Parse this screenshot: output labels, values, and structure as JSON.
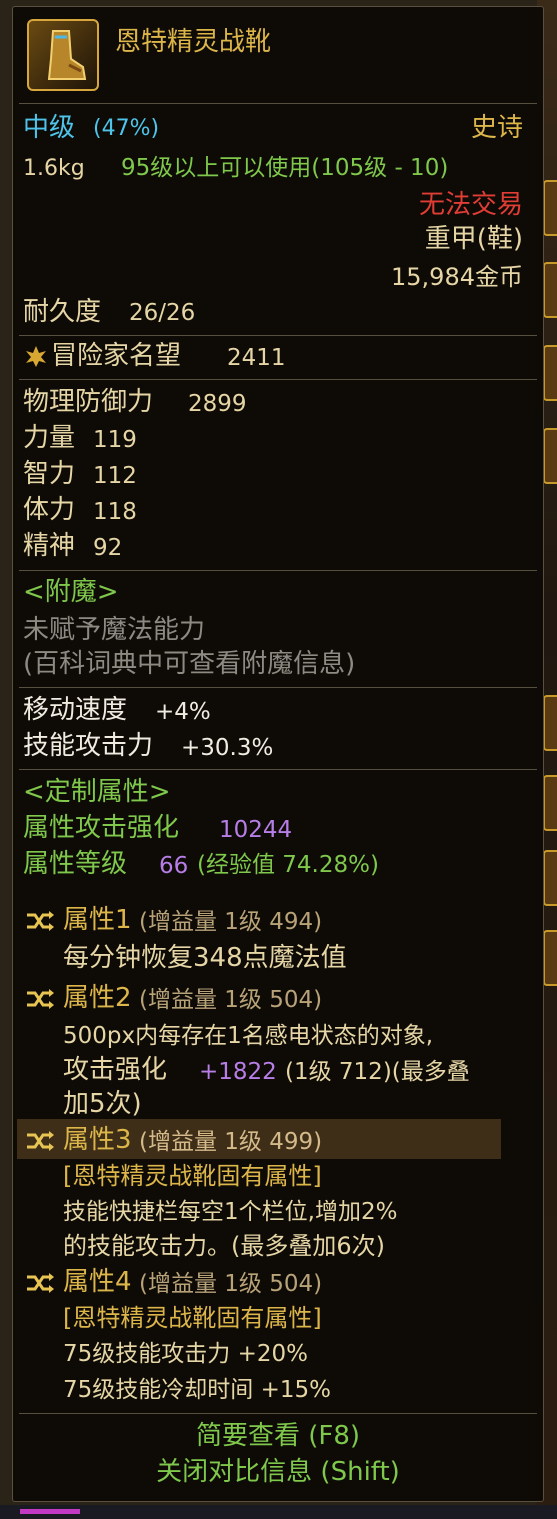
{
  "item": {
    "name": "恩特精灵战靴",
    "grade": "中级",
    "grade_pct": "(47%)",
    "rarity": "史诗",
    "weight": "1.6kg",
    "level_req": "95级以上可以使用(105级 - 10)",
    "trade": "无法交易",
    "type": "重甲(鞋)",
    "price": "15,984金币",
    "durability_label": "耐久度",
    "durability": "26/26",
    "reputation_label": "冒险家名望",
    "reputation": "2411",
    "icon": "boots-icon"
  },
  "stats": [
    {
      "label": "物理防御力",
      "value": "2899"
    },
    {
      "label": "力量",
      "value": "119"
    },
    {
      "label": "智力",
      "value": "112"
    },
    {
      "label": "体力",
      "value": "118"
    },
    {
      "label": "精神",
      "value": "92"
    }
  ],
  "enchant": {
    "header": "<附魔>",
    "line1": "未赋予魔法能力",
    "line2": "(百科词典中可查看附魔信息)"
  },
  "bonus": [
    {
      "label": "移动速度",
      "value": "+4%"
    },
    {
      "label": "技能攻击力",
      "value": "+30.3%"
    }
  ],
  "custom": {
    "header": "<定制属性>",
    "atk_label": "属性攻击强化",
    "atk_value": "10244",
    "lvl_label": "属性等级",
    "lvl_value": "66",
    "lvl_exp": "(经验值 74.28%)"
  },
  "attributes": [
    {
      "name": "属性1",
      "detail": "(增益量 1级 494)",
      "lines": [
        "每分钟恢复348点魔法值"
      ]
    },
    {
      "name": "属性2",
      "detail": "(增益量 1级 504)",
      "lines": [
        "500px内每存在1名感电状态的对象,"
      ],
      "l2a": "攻击强化",
      "l2b": "+1822",
      "l2c": "(1级 712)(最多叠",
      "l3": "加5次)"
    },
    {
      "name": "属性3",
      "detail": "(增益量 1级 499)",
      "tag": "[恩特精灵战靴固有属性]",
      "lines": [
        "技能快捷栏每空1个栏位,增加2%",
        "的技能攻击力。(最多叠加6次)"
      ]
    },
    {
      "name": "属性4",
      "detail": "(增益量 1级 504)",
      "tag": "[恩特精灵战靴固有属性]",
      "lines": [
        "75级技能攻击力 +20%",
        "75级技能冷却时间 +15%"
      ]
    }
  ],
  "footer": {
    "summary": "简要查看 (F8)",
    "compare": "关闭对比信息 (Shift)"
  },
  "colors": {
    "title": "#ddb64a",
    "grade": "#4fc4ea",
    "level_req": "#7fc84b",
    "trade": "#e23d34",
    "purple_value": "#b87ee8",
    "border": "#d7a63c"
  }
}
